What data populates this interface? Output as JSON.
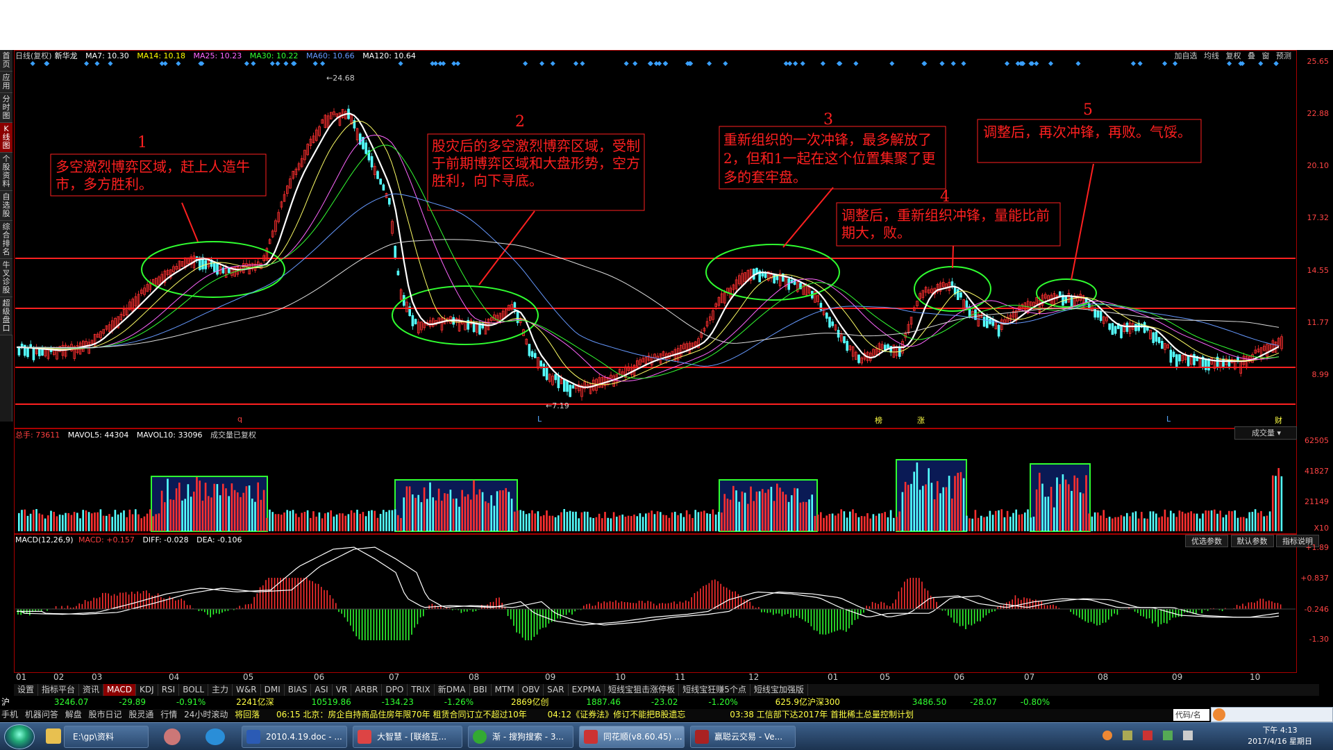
{
  "chart_header": {
    "title": "日线(复权)",
    "stock": "新华龙",
    "ma7": "MA7: 10.30",
    "ma14": "MA14: 10.18",
    "ma25": "MA25: 10.23",
    "ma30": "MA30: 10.22",
    "ma60": "MA60: 10.66",
    "ma120": "MA120: 10.64"
  },
  "top_right_menu": [
    "加自选",
    "均线",
    "复权",
    "叠",
    "窗",
    "预测"
  ],
  "left_tabs": [
    {
      "label": "首页"
    },
    {
      "label": "应用"
    },
    {
      "label": "分时图"
    },
    {
      "label": "K线图"
    },
    {
      "label": "个股资料"
    },
    {
      "label": "自选股"
    },
    {
      "label": "综合排名"
    },
    {
      "label": "牛叉诊股"
    },
    {
      "label": "超级盘口"
    }
  ],
  "price_axis": [
    "25.65",
    "22.88",
    "20.10",
    "17.32",
    "14.55",
    "11.77",
    "8.99"
  ],
  "price_marks": {
    "high": "24.68",
    "low": "7.19"
  },
  "event_marks": [
    "q",
    "L",
    "榜",
    "涨",
    "L",
    "财"
  ],
  "annotations": [
    {
      "num": "1",
      "text": "多空激烈博弈区域，赶上人造牛市，多方胜利。"
    },
    {
      "num": "2",
      "text": "股灾后的多空激烈博弈区域，受制于前期博弈区域和大盘形势，空方胜利，向下寻底。"
    },
    {
      "num": "3",
      "text": "重新组织的一次冲锋，最多解放了2，但和1一起在这个位置集聚了更多的套牢盘。"
    },
    {
      "num": "4",
      "text": "调整后，重新组织冲锋，量能比前期大，败。"
    },
    {
      "num": "5",
      "text": "调整后，再次冲锋，再败。气馁。"
    }
  ],
  "volume_header": {
    "total": "总手: 73611",
    "mavol5": "MAVOL5: 44304",
    "mavol10": "MAVOL10: 33096",
    "note": "成交量已复权"
  },
  "volume_select": "成交量",
  "volume_axis": [
    "62505",
    "41827",
    "21149",
    "X10"
  ],
  "macd_header": {
    "name": "MACD(12,26,9)",
    "macd": "MACD: +0.157",
    "diff": "DIFF: -0.028",
    "dea": "DEA: -0.106"
  },
  "macd_buttons": [
    "优选参数",
    "默认参数",
    "指标说明"
  ],
  "macd_axis": [
    "+1.89",
    "+0.837",
    "-0.246",
    "-1.30"
  ],
  "month_labels": [
    "01",
    "02",
    "03",
    "04",
    "05",
    "06",
    "07",
    "08",
    "09",
    "10",
    "11",
    "12",
    "01",
    "05",
    "06",
    "07",
    "08",
    "09",
    "10"
  ],
  "indicator_tabs": [
    "设置",
    "指标平台",
    "资讯",
    "MACD",
    "KDJ",
    "RSI",
    "BOLL",
    "主力",
    "W&R",
    "DMI",
    "BIAS",
    "ASI",
    "VR",
    "ARBR",
    "DPO",
    "TRIX",
    "新DMA",
    "BBI",
    "MTM",
    "OBV",
    "SAR",
    "EXPMA",
    "短线宝狙击涨停板",
    "短线宝狂赚5个点",
    "短线宝加强版"
  ],
  "ticker1": {
    "sh": "沪",
    "sh_index": "3246.07",
    "sh_chg": "-29.89",
    "sh_pct": "-0.91%",
    "sh_amt": "2241亿深",
    "sz_index": "10519.86",
    "sz_chg": "-134.23",
    "sz_pct": "-1.26%",
    "cy_amt": "2869亿创",
    "cy_index": "1887.46",
    "cy_chg": "-23.02",
    "cy_pct": "-1.20%",
    "hs_amt": "625.9亿沪深300",
    "hs_index": "3486.50",
    "hs_chg": "-28.07",
    "hs_pct": "-0.80%"
  },
  "ticker2": {
    "items": [
      "手机",
      "机器问答",
      "解盘",
      "股市日记",
      "股灵通",
      "行情",
      "24小时滚动"
    ],
    "hot": "将回落",
    "news1": "06:15 北京：房企自持商品住房年限70年 租赁合同订立不超过10年",
    "news2": "04:12《证券法》修订不能把B股遗忘",
    "news3": "03:38 工信部下达2017年 首批稀土总量控制计划",
    "code": "代码/名"
  },
  "taskbar": {
    "start": "start",
    "items": [
      "E:\\gp\\资料",
      "2010.4.19.doc - ...",
      "大智慧 - [联络互...",
      "渐 - 搜狗搜索 - 3...",
      "同花顺(v8.60.45) ...",
      "赢聪云交易 - Ve..."
    ],
    "time": "下午 4:13",
    "date": "2017/4/16 星期日"
  },
  "colors": {
    "up": "#ff3030",
    "down": "#54ffff",
    "frame": "#aa0000",
    "annotation": "#ff2020",
    "circle": "#30ff30",
    "boxfill": "#0a1a55"
  }
}
